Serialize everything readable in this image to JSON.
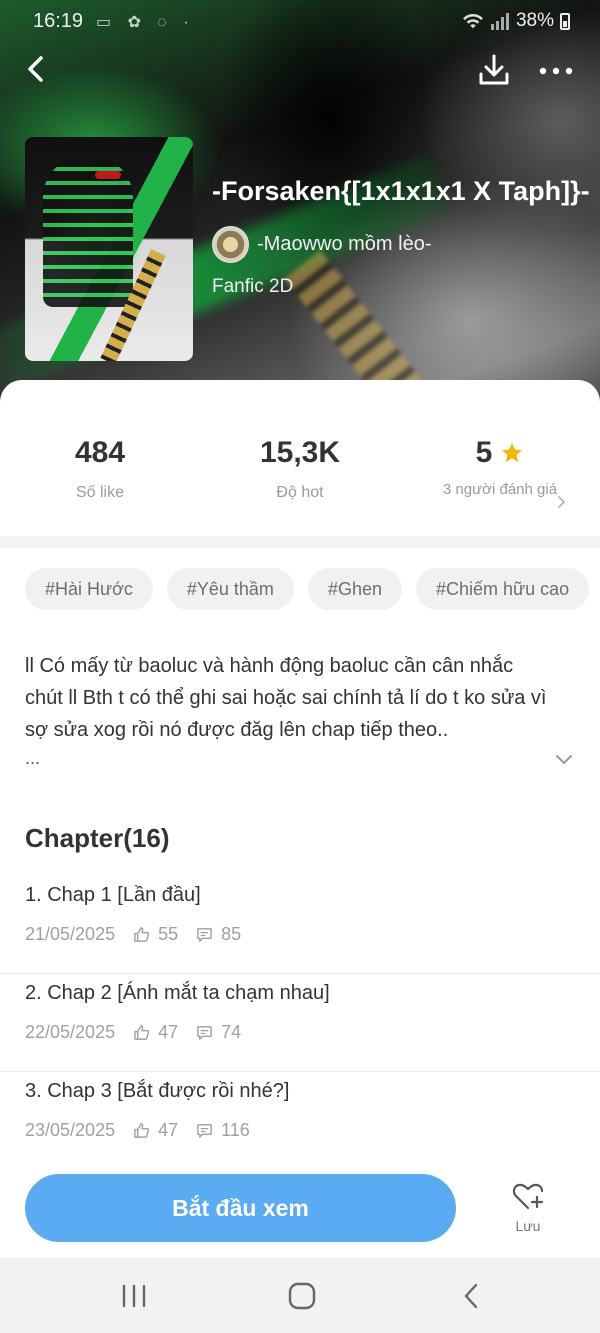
{
  "status_bar": {
    "time": "16:19",
    "left_icons": "▭ ✿ ◌ ·",
    "battery": "38%"
  },
  "story": {
    "title": "-Forsaken{[1x1x1x1 X Taph]}-",
    "author": "-Maowwo mồm lèo-",
    "genre": "Fanfic 2D"
  },
  "stats": {
    "likes": {
      "value": "484",
      "label": "Số like"
    },
    "hot": {
      "value": "15,3K",
      "label": "Độ hot"
    },
    "rating": {
      "value": "5",
      "label": "3 người đánh giá"
    }
  },
  "tags": [
    "#Hài Hước",
    "#Yêu thầm",
    "#Ghen",
    "#Chiếm hữu cao"
  ],
  "description": {
    "text": "ll Có mấy từ baoluc và hành động baoluc cần cân nhắc chút ll Bth t có thể ghi sai hoặc sai chính tả lí do t ko sửa vì sợ sửa xog rồi nó được đăg lên chap tiếp theo..",
    "more": "..."
  },
  "chapters": {
    "heading": "Chapter(16)",
    "items": [
      {
        "title": "1. Chap 1 [Lần đầu]",
        "date": "21/05/2025",
        "likes": "55",
        "comments": "85"
      },
      {
        "title": "2. Chap 2 [Ánh mắt ta chạm nhau]",
        "date": "22/05/2025",
        "likes": "47",
        "comments": "74"
      },
      {
        "title": "3. Chap 3 [Bắt được rồi nhé?]",
        "date": "23/05/2025",
        "likes": "47",
        "comments": "116"
      }
    ]
  },
  "actions": {
    "start": "Bắt đầu xem",
    "save": "Lưu"
  },
  "colors": {
    "accent": "#5aabf2",
    "star": "#f5b800"
  },
  "icons": [
    "back-icon",
    "download-icon",
    "more-icon",
    "star-icon",
    "chevron-right-icon",
    "chevron-down-icon",
    "thumb-up-icon",
    "comment-icon",
    "heart-plus-icon",
    "recent-apps-icon",
    "home-icon",
    "nav-back-icon"
  ]
}
